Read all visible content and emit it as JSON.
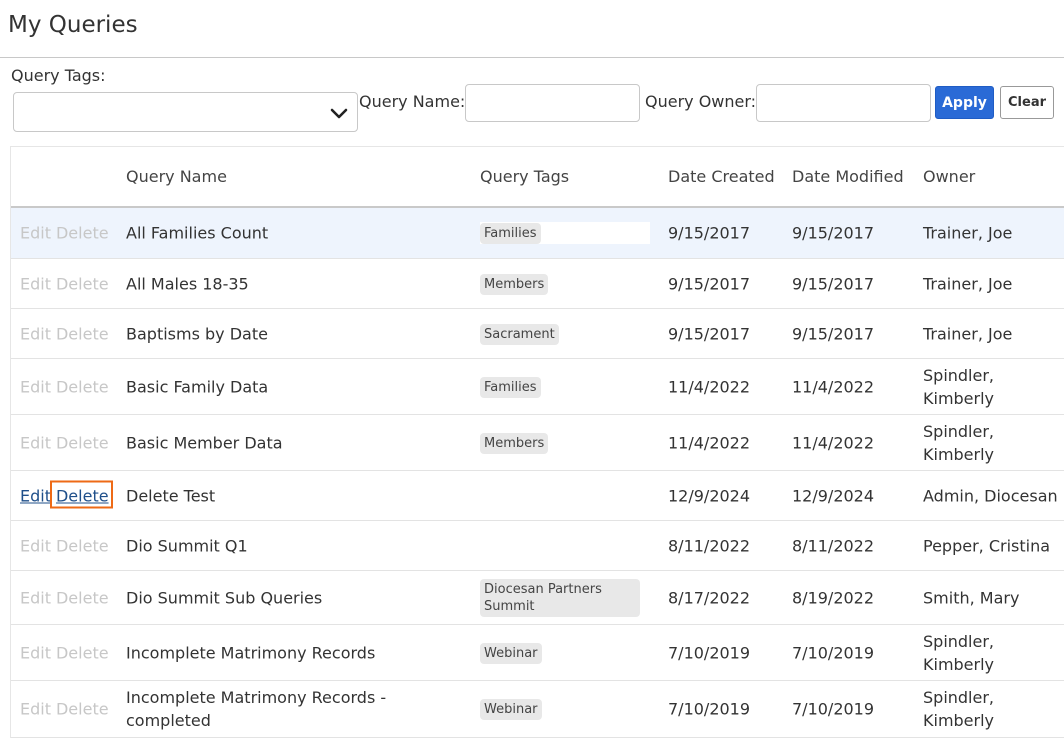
{
  "page_title": "My Queries",
  "filters": {
    "tags_label": "Query Tags:",
    "tags_value": "",
    "name_label": "Query Name:",
    "name_value": "",
    "owner_label": "Query Owner:",
    "owner_value": "",
    "apply_label": "Apply",
    "clear_label": "Clear"
  },
  "table": {
    "headers": {
      "name": "Query Name",
      "tags": "Query Tags",
      "created": "Date Created",
      "modified": "Date Modified",
      "owner": "Owner"
    },
    "edit_label": "Edit",
    "delete_label": "Delete",
    "rows": [
      {
        "name": "All Families Count",
        "tag": "Families",
        "created": "9/15/2017",
        "modified": "9/15/2017",
        "owner": "Trainer, Joe"
      },
      {
        "name": "All Males 18-35",
        "tag": "Members",
        "created": "9/15/2017",
        "modified": "9/15/2017",
        "owner": "Trainer, Joe"
      },
      {
        "name": "Baptisms by Date",
        "tag": "Sacrament",
        "created": "9/15/2017",
        "modified": "9/15/2017",
        "owner": "Trainer, Joe"
      },
      {
        "name": "Basic Family Data",
        "tag": "Families",
        "created": "11/4/2022",
        "modified": "11/4/2022",
        "owner": "Spindler, Kimberly"
      },
      {
        "name": "Basic Member Data",
        "tag": "Members",
        "created": "11/4/2022",
        "modified": "11/4/2022",
        "owner": "Spindler, Kimberly"
      },
      {
        "name": "Delete Test",
        "tag": "",
        "created": "12/9/2024",
        "modified": "12/9/2024",
        "owner": "Admin, Diocesan"
      },
      {
        "name": "Dio Summit Q1",
        "tag": "",
        "created": "8/11/2022",
        "modified": "8/11/2022",
        "owner": "Pepper, Cristina"
      },
      {
        "name": "Dio Summit Sub Queries",
        "tag": "Diocesan Partners Summit",
        "created": "8/17/2022",
        "modified": "8/19/2022",
        "owner": "Smith, Mary"
      },
      {
        "name": "Incomplete Matrimony Records",
        "tag": "Webinar",
        "created": "7/10/2019",
        "modified": "7/10/2019",
        "owner": "Spindler, Kimberly"
      },
      {
        "name": "Incomplete Matrimony Records - completed",
        "tag": "Webinar",
        "created": "7/10/2019",
        "modified": "7/10/2019",
        "owner": "Spindler, Kimberly"
      }
    ]
  }
}
